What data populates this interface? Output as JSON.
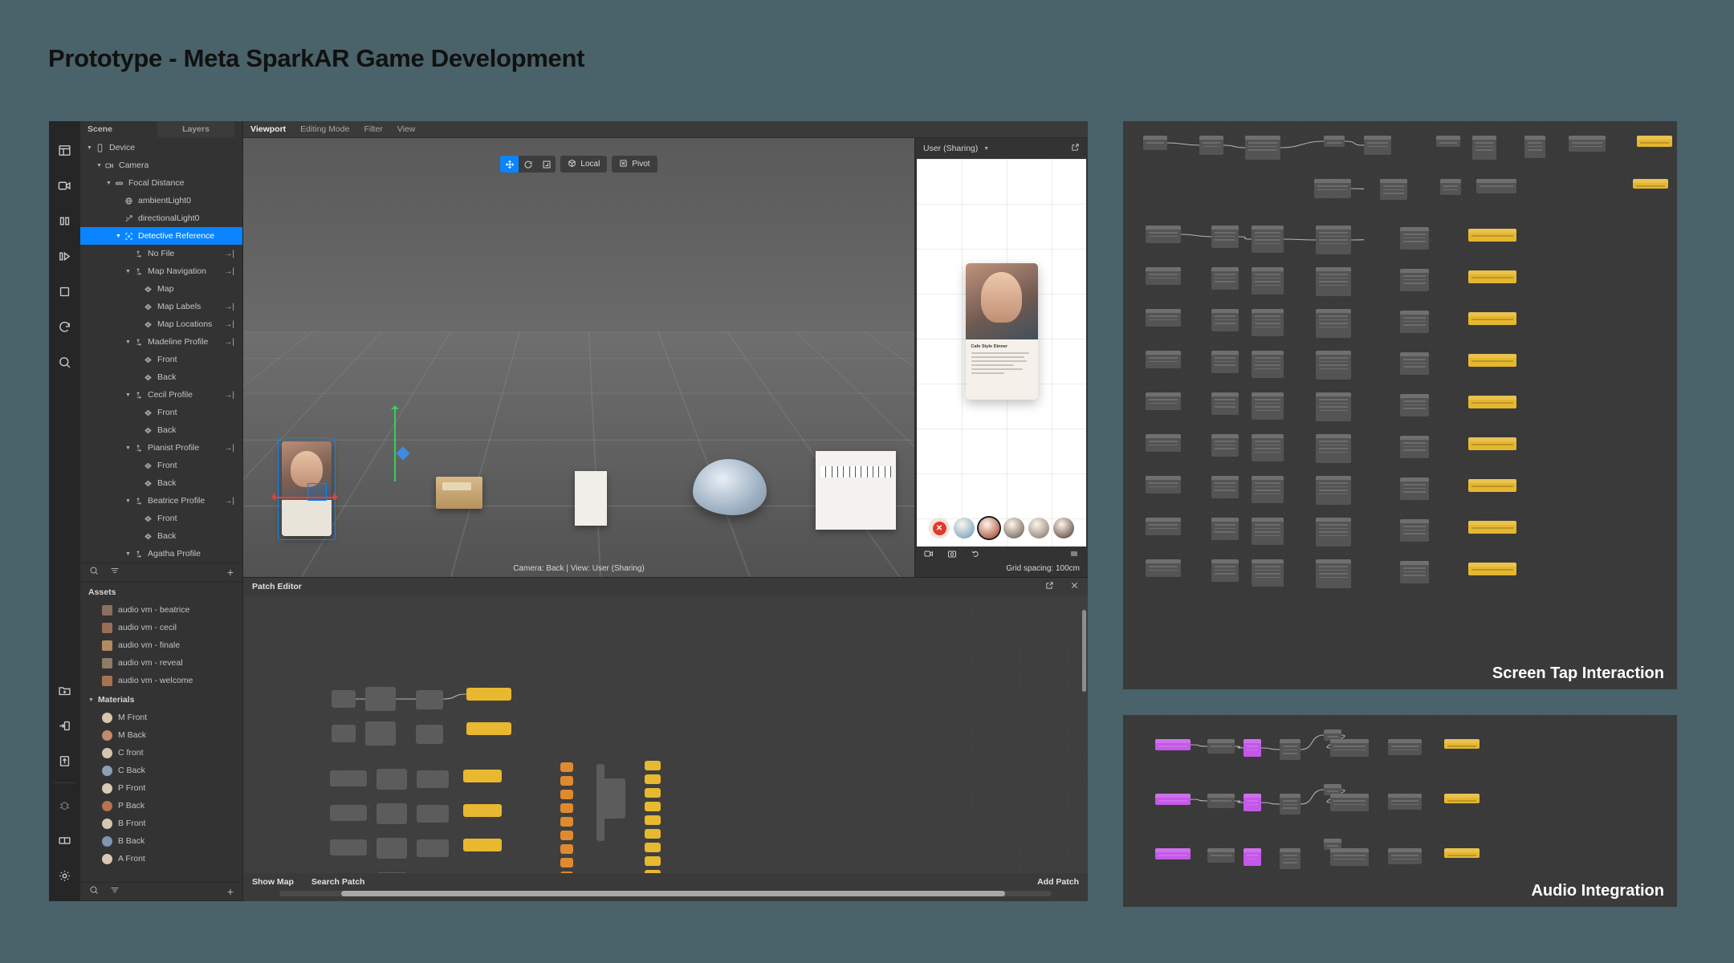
{
  "page": {
    "title": "Prototype - Meta SparkAR Game Development"
  },
  "scene_panel": {
    "tabs": [
      {
        "label": "Scene",
        "active": true
      },
      {
        "label": "Layers",
        "active": false
      }
    ],
    "tree": [
      {
        "label": "Device",
        "depth": 0,
        "caret": "▼",
        "icon": "device-icon",
        "flag": ""
      },
      {
        "label": "Camera",
        "depth": 1,
        "caret": "▼",
        "icon": "camera-icon",
        "flag": ""
      },
      {
        "label": "Focal Distance",
        "depth": 2,
        "caret": "▼",
        "icon": "focal-icon",
        "flag": ""
      },
      {
        "label": "ambientLight0",
        "depth": 3,
        "caret": "",
        "icon": "ambient-light-icon",
        "flag": ""
      },
      {
        "label": "directionalLight0",
        "depth": 3,
        "caret": "",
        "icon": "directional-light-icon",
        "flag": ""
      },
      {
        "label": "Detective Reference",
        "depth": 3,
        "caret": "▼",
        "icon": "tracker-icon",
        "flag": "",
        "selected": true
      },
      {
        "label": "No File",
        "depth": 4,
        "caret": "",
        "icon": "null-object-icon",
        "flag": "→|"
      },
      {
        "label": "Map Navigation",
        "depth": 4,
        "caret": "▼",
        "icon": "null-object-icon",
        "flag": "→|"
      },
      {
        "label": "Map",
        "depth": 5,
        "caret": "",
        "icon": "plane-icon",
        "flag": ""
      },
      {
        "label": "Map Labels",
        "depth": 5,
        "caret": "",
        "icon": "plane-icon",
        "flag": "→|"
      },
      {
        "label": "Map Locations",
        "depth": 5,
        "caret": "",
        "icon": "plane-icon",
        "flag": "→|"
      },
      {
        "label": "Madeline Profile",
        "depth": 4,
        "caret": "▼",
        "icon": "null-object-icon",
        "flag": "→|"
      },
      {
        "label": "Front",
        "depth": 5,
        "caret": "",
        "icon": "plane-icon",
        "flag": ""
      },
      {
        "label": "Back",
        "depth": 5,
        "caret": "",
        "icon": "plane-icon",
        "flag": ""
      },
      {
        "label": "Cecil Profile",
        "depth": 4,
        "caret": "▼",
        "icon": "null-object-icon",
        "flag": "→|"
      },
      {
        "label": "Front",
        "depth": 5,
        "caret": "",
        "icon": "plane-icon",
        "flag": ""
      },
      {
        "label": "Back",
        "depth": 5,
        "caret": "",
        "icon": "plane-icon",
        "flag": ""
      },
      {
        "label": "Pianist Profile",
        "depth": 4,
        "caret": "▼",
        "icon": "null-object-icon",
        "flag": "→|"
      },
      {
        "label": "Front",
        "depth": 5,
        "caret": "",
        "icon": "plane-icon",
        "flag": ""
      },
      {
        "label": "Back",
        "depth": 5,
        "caret": "",
        "icon": "plane-icon",
        "flag": ""
      },
      {
        "label": "Beatrice Profile",
        "depth": 4,
        "caret": "▼",
        "icon": "null-object-icon",
        "flag": "→|"
      },
      {
        "label": "Front",
        "depth": 5,
        "caret": "",
        "icon": "plane-icon",
        "flag": ""
      },
      {
        "label": "Back",
        "depth": 5,
        "caret": "",
        "icon": "plane-icon",
        "flag": ""
      },
      {
        "label": "Agatha Profile",
        "depth": 4,
        "caret": "▼",
        "icon": "null-object-icon",
        "flag": ""
      }
    ],
    "assets": {
      "header": "Assets",
      "items": [
        {
          "label": "audio vm - beatrice",
          "color": "#8c6f5e"
        },
        {
          "label": "audio vm - cecil",
          "color": "#9a6d57"
        },
        {
          "label": "audio vm - finale",
          "color": "#b48a62"
        },
        {
          "label": "audio vm - reveal",
          "color": "#8d7b66"
        },
        {
          "label": "audio vm - welcome",
          "color": "#a8714f"
        }
      ]
    },
    "materials": {
      "header": "Materials",
      "items": [
        {
          "label": "M Front",
          "color": "#d9c6ad"
        },
        {
          "label": "M Back",
          "color": "#c08a6e"
        },
        {
          "label": "C front",
          "color": "#d6c5ae"
        },
        {
          "label": "C Back",
          "color": "#8ba0b4"
        },
        {
          "label": "P Front",
          "color": "#d9cbb4"
        },
        {
          "label": "P Back",
          "color": "#b5744f"
        },
        {
          "label": "B Front",
          "color": "#d5c7b1"
        },
        {
          "label": "B Back",
          "color": "#7e97b1"
        },
        {
          "label": "A Front",
          "color": "#dac9b0"
        }
      ]
    }
  },
  "icon_rail": {
    "top": [
      "layout-icon",
      "camera-icon",
      "pause-icon",
      "play-step-icon",
      "square-icon",
      "refresh-icon",
      "search-icon"
    ],
    "bottom": [
      "add-folder-icon",
      "import-icon",
      "export-icon",
      "bug-icon",
      "panels-icon",
      "settings-icon"
    ]
  },
  "menu_bar": {
    "items": [
      {
        "label": "Viewport",
        "active": true
      },
      {
        "label": "Editing Mode",
        "active": false
      },
      {
        "label": "Filter",
        "active": false
      },
      {
        "label": "View",
        "active": false
      }
    ]
  },
  "viewport": {
    "tools": [
      {
        "name": "move-tool",
        "active": true
      },
      {
        "name": "rotate-tool",
        "active": false
      },
      {
        "name": "scale-tool",
        "active": false
      }
    ],
    "space_label": "Local",
    "pivot_label": "Pivot",
    "status": "Camera: Back | View: User (Sharing)"
  },
  "simulator": {
    "dropdown_value": "User (Sharing)",
    "grid_spacing": "Grid spacing: 100cm",
    "card": {
      "title": "Cafe Style Dinner",
      "lines": 6
    },
    "avatars": [
      {
        "name": "avatar-clear",
        "type": "clear"
      },
      {
        "name": "avatar-map",
        "color": "#8fb4c9"
      },
      {
        "name": "avatar-madeline",
        "color": "#b9705b",
        "selected": true
      },
      {
        "name": "avatar-cecil",
        "color": "#8c8177"
      },
      {
        "name": "avatar-pianist",
        "color": "#a4948a"
      },
      {
        "name": "avatar-beatrice",
        "color": "#7e6a62"
      }
    ],
    "footer_icons": [
      "record-icon",
      "screenshot-icon",
      "reload-icon",
      "menu-icon"
    ]
  },
  "patch_editor": {
    "title": "Patch Editor",
    "show_map": "Show Map",
    "search_patch": "Search Patch",
    "add_patch": "Add Patch",
    "header_icons": [
      "expand-icon",
      "close-icon"
    ]
  },
  "right_panels": [
    {
      "id": "panel-tap",
      "label": "Screen Tap Interaction"
    },
    {
      "id": "panel-audio",
      "label": "Audio Integration"
    }
  ],
  "colors": {
    "background": "#4a6269",
    "panel": "#3a3a3a",
    "accent": "#0a84ff",
    "node_yellow": "#e5b72f",
    "node_orange": "#e08a2e",
    "node_magenta": "#c558e8"
  }
}
